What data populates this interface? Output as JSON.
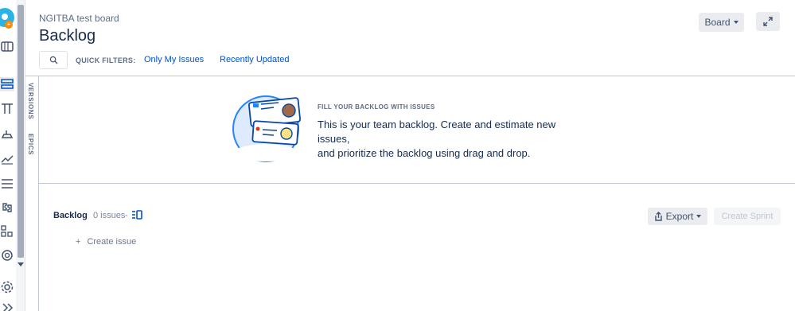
{
  "header": {
    "project_name": "NGITBA test board",
    "title": "Backlog",
    "board_button": "Board"
  },
  "filters": {
    "quick_filters_label": "QUICK FILTERS:",
    "items": [
      "Only My Issues",
      "Recently Updated"
    ]
  },
  "side_tabs": {
    "versions": "VERSIONS",
    "epics": "EPICS"
  },
  "empty_state": {
    "heading": "FILL YOUR BACKLOG WITH ISSUES",
    "line1": "This is your team backlog. Create and estimate new issues,",
    "line2": "and prioritize the backlog using drag and drop."
  },
  "backlog": {
    "title": "Backlog",
    "count": "0 issues",
    "separator": "-",
    "export_button": "Export",
    "create_sprint_button": "Create Sprint",
    "create_issue_plus": "+",
    "create_issue_label": "Create issue"
  },
  "sidebar": {
    "icons": [
      "app-logo-icon",
      "board-icon",
      "backlog-icon",
      "active-sprints-icon",
      "releases-icon",
      "reports-icon",
      "issues-icon",
      "components-icon",
      "add-item-icon",
      "project-pages-icon",
      "settings-icon",
      "collapse-icon"
    ]
  },
  "colors": {
    "link": "#0052cc",
    "text": "#172b4d",
    "muted": "#5e6c84",
    "button_bg": "#ebecf0",
    "illustration": "#2684ff"
  }
}
